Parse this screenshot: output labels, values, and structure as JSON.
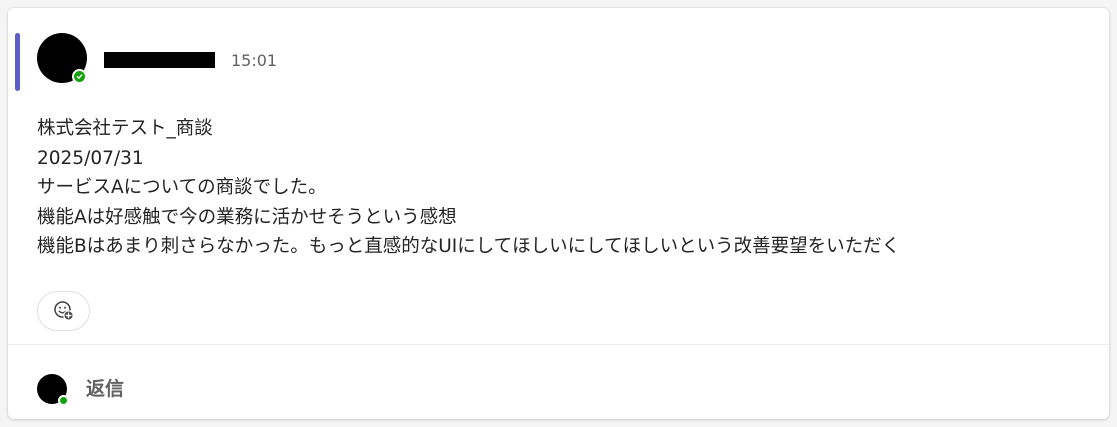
{
  "post": {
    "timestamp": "15:01",
    "message_lines": [
      "株式会社テスト_商談",
      "2025/07/31",
      "サービスAについての商談でした。",
      "機能Aは好感触で今の業務に活かせそうという感想",
      "機能Bはあまり刺さらなかった。もっと直感的なUIにしてほしいにしてほしいという改善要望をいただく"
    ],
    "reaction_icon": "emoji-add-icon",
    "presence_status": "available",
    "presence_color": "#13a10e"
  },
  "reply": {
    "label": "返信"
  },
  "colors": {
    "accent": "#5b5fc7",
    "text": "#242424",
    "muted": "#616161"
  }
}
